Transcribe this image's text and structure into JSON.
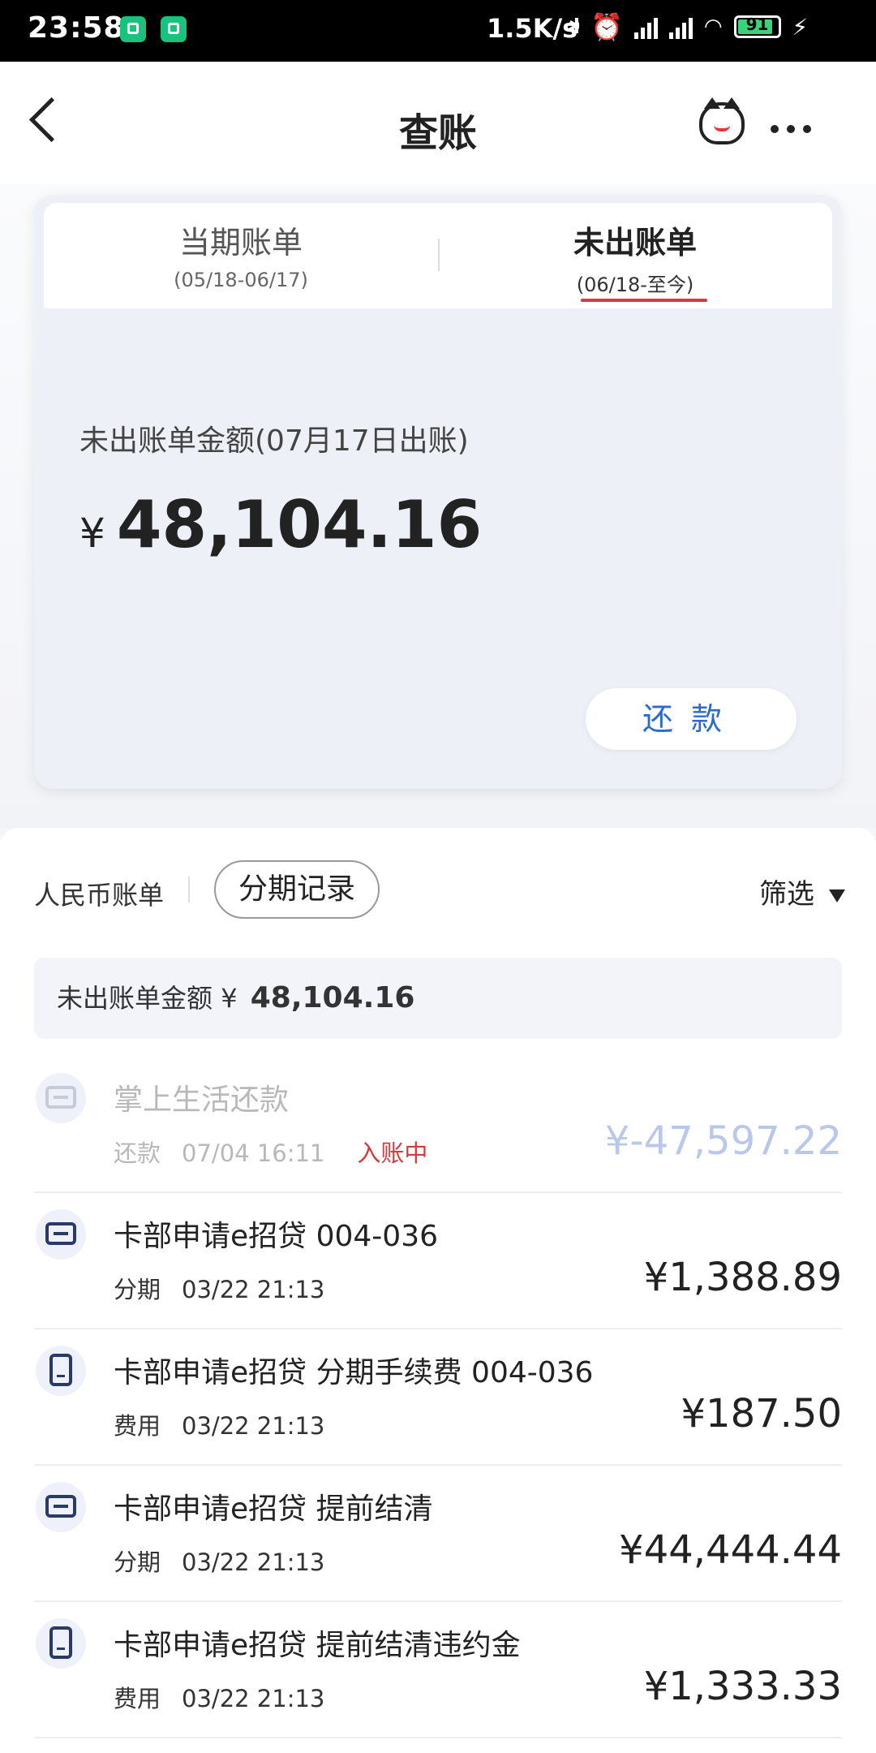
{
  "status_bar": {
    "time": "23:58",
    "net_speed": "1.5K/s",
    "battery": "91"
  },
  "header": {
    "title": "查账"
  },
  "bill_tabs": [
    {
      "label": "当期账单",
      "dates": "(05/18-06/17)"
    },
    {
      "label": "未出账单",
      "dates": "(06/18-至今)"
    }
  ],
  "card": {
    "amount_label": "未出账单金额(07月17日出账)",
    "currency": "¥",
    "amount": "48,104.16",
    "repay_button": "还款"
  },
  "filters": {
    "rmb_bill": "人民币账单",
    "installment_records": "分期记录",
    "filter": "筛选"
  },
  "summary": {
    "label": "未出账单金额",
    "currency": "¥",
    "amount": "48,104.16"
  },
  "transactions": [
    {
      "desc": "掌上生活还款",
      "type": "还款",
      "time": "07/04 16:11",
      "status": "入账中",
      "amount": "¥-47,597.22",
      "icon": "wallet-icon"
    },
    {
      "desc": "卡部申请e招贷 004-036",
      "type": "分期",
      "time": "03/22 21:13",
      "amount": "¥1,388.89",
      "icon": "installment-icon"
    },
    {
      "desc": "卡部申请e招贷 分期手续费 004-036",
      "type": "费用",
      "time": "03/22 21:13",
      "amount": "¥187.50",
      "icon": "fee-icon"
    },
    {
      "desc": "卡部申请e招贷 提前结清",
      "type": "分期",
      "time": "03/22 21:13",
      "amount": "¥44,444.44",
      "icon": "installment-icon"
    },
    {
      "desc": "卡部申请e招贷 提前结清违约金",
      "type": "费用",
      "time": "03/22 21:13",
      "amount": "¥1,333.33",
      "icon": "fee-icon"
    }
  ]
}
